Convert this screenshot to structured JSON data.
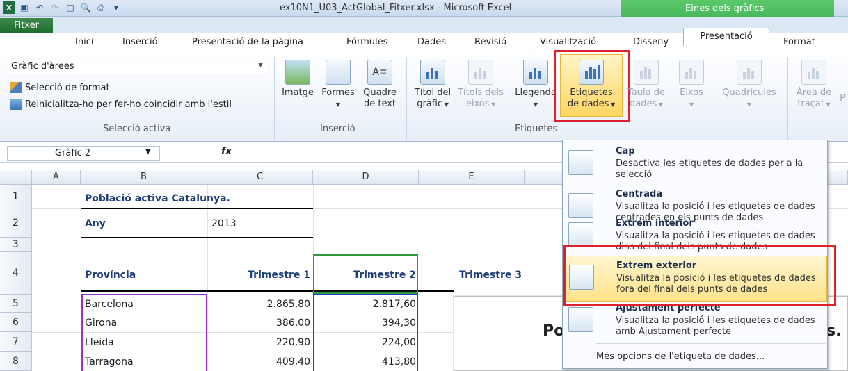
{
  "window": {
    "title": "ex10N1_U03_ActGlobal_Fitxer.xlsx - Microsoft Excel",
    "context_tab_title": "Eines dels gràfics"
  },
  "tabs": {
    "file": "Fitxer",
    "items": [
      "Inici",
      "Inserció",
      "Presentació de la pàgina",
      "Fórmules",
      "Dades",
      "Revisió",
      "Visualització"
    ],
    "context": [
      "Disseny",
      "Presentació",
      "Format"
    ]
  },
  "ribbon": {
    "selection": {
      "dropdown_value": "Gràfic d'àrees",
      "format_selection": "Selecció de format",
      "reset_style": "Reinicialitza-ho per fer-ho coincidir amb l'estil",
      "group_label": "Selecció activa"
    },
    "insert": {
      "image": "Imatge",
      "shapes": "Formes",
      "textbox_l1": "Quadre",
      "textbox_l2": "de text",
      "group_label": "Inserció"
    },
    "labels": {
      "chart_title_l1": "Títol del",
      "chart_title_l2": "gràfic",
      "axis_titles_l1": "Títols dels",
      "axis_titles_l2": "eixos",
      "legend": "Llegenda",
      "data_labels_l1": "Etiquetes",
      "data_labels_l2": "de dades",
      "data_table_l1": "Taula de",
      "data_table_l2": "dades",
      "group_label": "Etiquetes"
    },
    "axes": {
      "axes": "Eixos",
      "gridlines": "Quadrícules"
    },
    "background": {
      "plot_area_l1": "Àrea de",
      "plot_area_l2": "traçat",
      "cut_label": "P"
    }
  },
  "formula_bar": {
    "name_box": "Gràfic 2",
    "fx": "fx"
  },
  "grid": {
    "columns": [
      "A",
      "B",
      "C",
      "D",
      "E"
    ],
    "rows": [
      "1",
      "2",
      "3",
      "4",
      "5",
      "6",
      "7",
      "8"
    ],
    "title": "Població activa Catalunya.",
    "year_label": "Any",
    "year_value": "2013",
    "headers": {
      "province": "Província",
      "q1": "Trimestre 1",
      "q2": "Trimestre 2",
      "q3": "Trimestre 3"
    },
    "data": [
      {
        "province": "Barcelona",
        "q1": "2.865,80",
        "q2": "2.817,60"
      },
      {
        "province": "Girona",
        "q1": "386,00",
        "q2": "394,30"
      },
      {
        "province": "Lleida",
        "q1": "220,90",
        "q2": "224,00"
      },
      {
        "province": "Tarragona",
        "q1": "409,40",
        "q2": "413,80"
      }
    ]
  },
  "chart": {
    "title_left": "Po",
    "title_right": "s."
  },
  "menu": {
    "items": [
      {
        "title": "Cap",
        "desc": "Desactiva les etiquetes de dades per a la selecció"
      },
      {
        "title": "Centrada",
        "desc": "Visualitza la posició i les etiquetes de dades centrades en els punts de dades"
      },
      {
        "title": "Extrem interior",
        "desc": "Visualitza la posició i les etiquetes de dades dins del final dels punts de dades"
      },
      {
        "title": "Extrem exterior",
        "desc": "Visualitza la posició i les etiquetes de dades fora del final dels punts de dades"
      },
      {
        "title": "Ajustament perfecte",
        "desc": "Visualitza la posició i les etiquetes de dades amb Ajustament perfecte"
      }
    ],
    "more": "Més opcions de l'etiqueta de dades..."
  }
}
